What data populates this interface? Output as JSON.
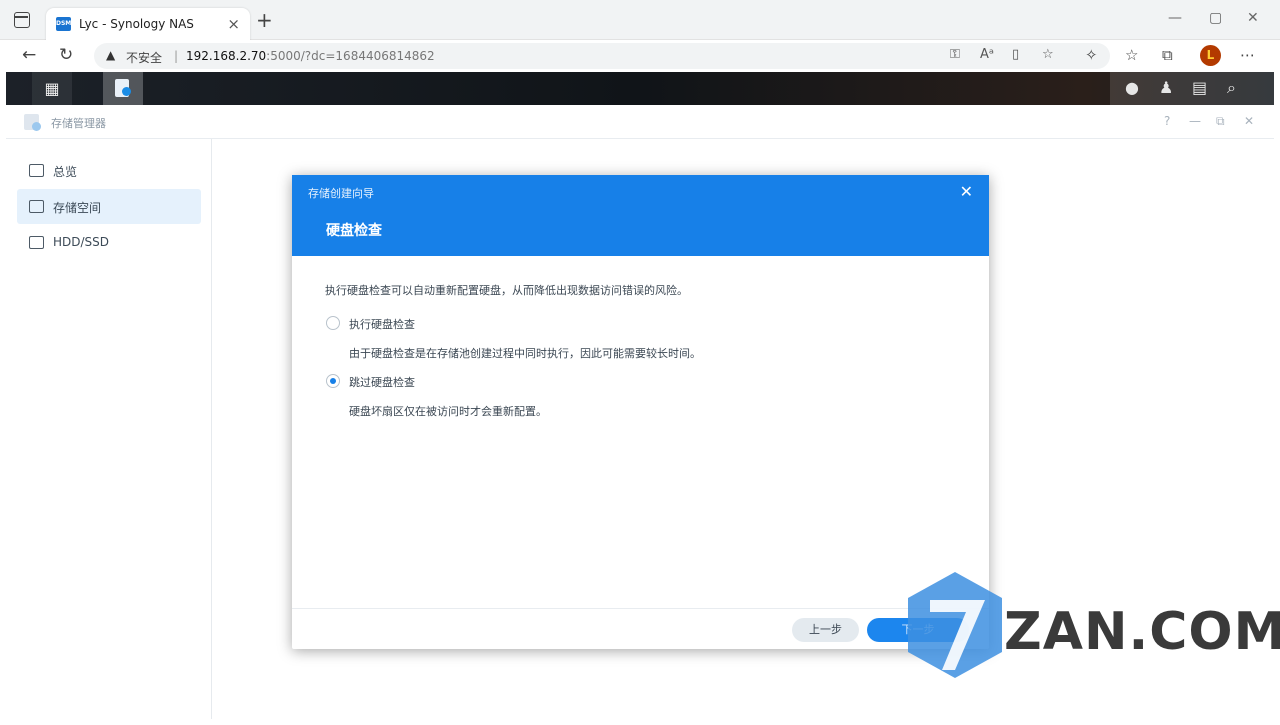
{
  "browser": {
    "tab_title": "Lyc - Synology NAS",
    "tab_favicon_text": "DSM",
    "security_label": "不安全",
    "url_host": "192.168.2.70",
    "url_rest": ":5000/?dc=1684406814862",
    "profile_initial": "L"
  },
  "app": {
    "title": "存储管理器"
  },
  "sidebar": {
    "items": [
      {
        "label": "总览"
      },
      {
        "label": "存储空间"
      },
      {
        "label": "HDD/SSD"
      }
    ]
  },
  "modal": {
    "wizard_title": "存储创建向导",
    "step_title": "硬盘检查",
    "description": "执行硬盘检查可以自动重新配置硬盘，从而降低出现数据访问错误的风险。",
    "options": [
      {
        "label": "执行硬盘检查",
        "note": "由于硬盘检查是在存储池创建过程中同时执行，因此可能需要较长时间。",
        "checked": false
      },
      {
        "label": "跳过硬盘检查",
        "note": "硬盘坏扇区仅在被访问时才会重新配置。",
        "checked": true
      }
    ],
    "prev_label": "上一步",
    "next_label": "下一步"
  },
  "watermark": {
    "glyph": "7",
    "text": "ZAN.COM"
  },
  "colors": {
    "accent": "#1780e8",
    "sidebar_active": "#e5f1fc"
  }
}
